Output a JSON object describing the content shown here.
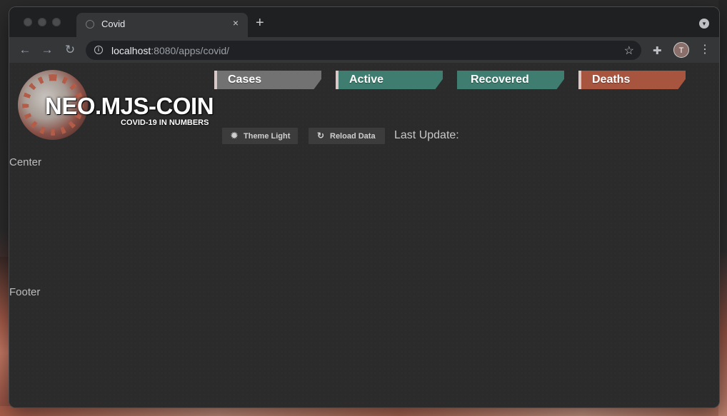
{
  "browser": {
    "tab_title": "Covid",
    "tab_close": "×",
    "new_tab": "+",
    "url_host": "localhost",
    "url_rest": ":8080/apps/covid/",
    "icons": [
      "back-arrow-icon",
      "forward-arrow-icon",
      "reload-icon",
      "info-icon",
      "star-icon",
      "extensions-icon",
      "avatar",
      "menu-icon"
    ],
    "profile_initial": "T"
  },
  "header": {
    "logo_title": "NEO.MJS-COIN",
    "logo_subtitle": "COVID-19 IN NUMBERS",
    "stats": [
      {
        "label": "Cases",
        "color": "#727272"
      },
      {
        "label": "Active",
        "color": "#3e7d70"
      },
      {
        "label": "Recovered",
        "color": "#3e7d70"
      },
      {
        "label": "Deaths",
        "color": "#a85540"
      }
    ],
    "theme_button": "Theme Light",
    "reload_button": "Reload Data",
    "last_update": "Last Update:"
  },
  "regions": {
    "center": "Center",
    "footer": "Footer"
  }
}
